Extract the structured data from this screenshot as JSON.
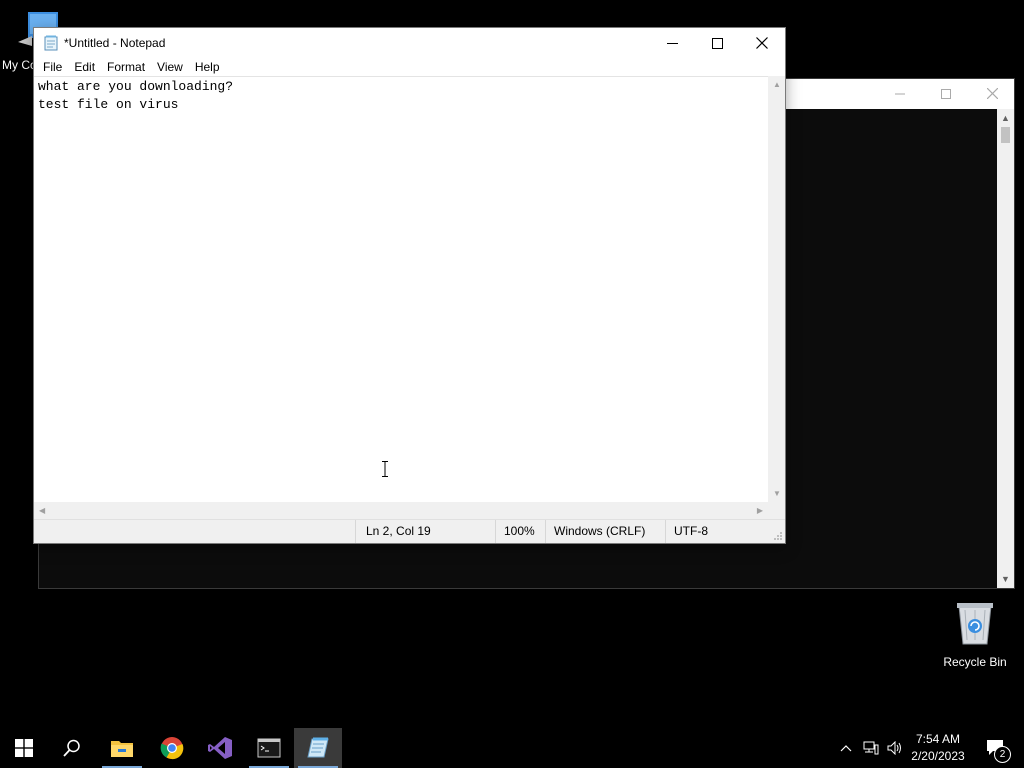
{
  "desktop": {
    "icons": [
      {
        "label": "My Co",
        "icon": "computer-icon"
      },
      {
        "label": "Recycle Bin",
        "icon": "recycle-bin-icon"
      }
    ]
  },
  "notepad": {
    "title": "*Untitled - Notepad",
    "menu": [
      "File",
      "Edit",
      "Format",
      "View",
      "Help"
    ],
    "content": "what are you downloading?\ntest file on virus",
    "status": {
      "position": "Ln 2, Col 19",
      "zoom": "100%",
      "line_ending": "Windows (CRLF)",
      "encoding": "UTF-8"
    }
  },
  "taskbar": {
    "apps": [
      "start-icon",
      "search-icon",
      "file-explorer-icon",
      "chrome-icon",
      "visual-studio-icon",
      "command-prompt-icon",
      "notepad-icon"
    ],
    "clock": {
      "time": "7:54 AM",
      "date": "2/20/2023"
    },
    "notifications_count": "2"
  },
  "colors": {
    "desktop": "#000000",
    "taskbar": "#000000",
    "window_bg": "#ffffff",
    "accent_indicator": "#7aa8d8"
  }
}
